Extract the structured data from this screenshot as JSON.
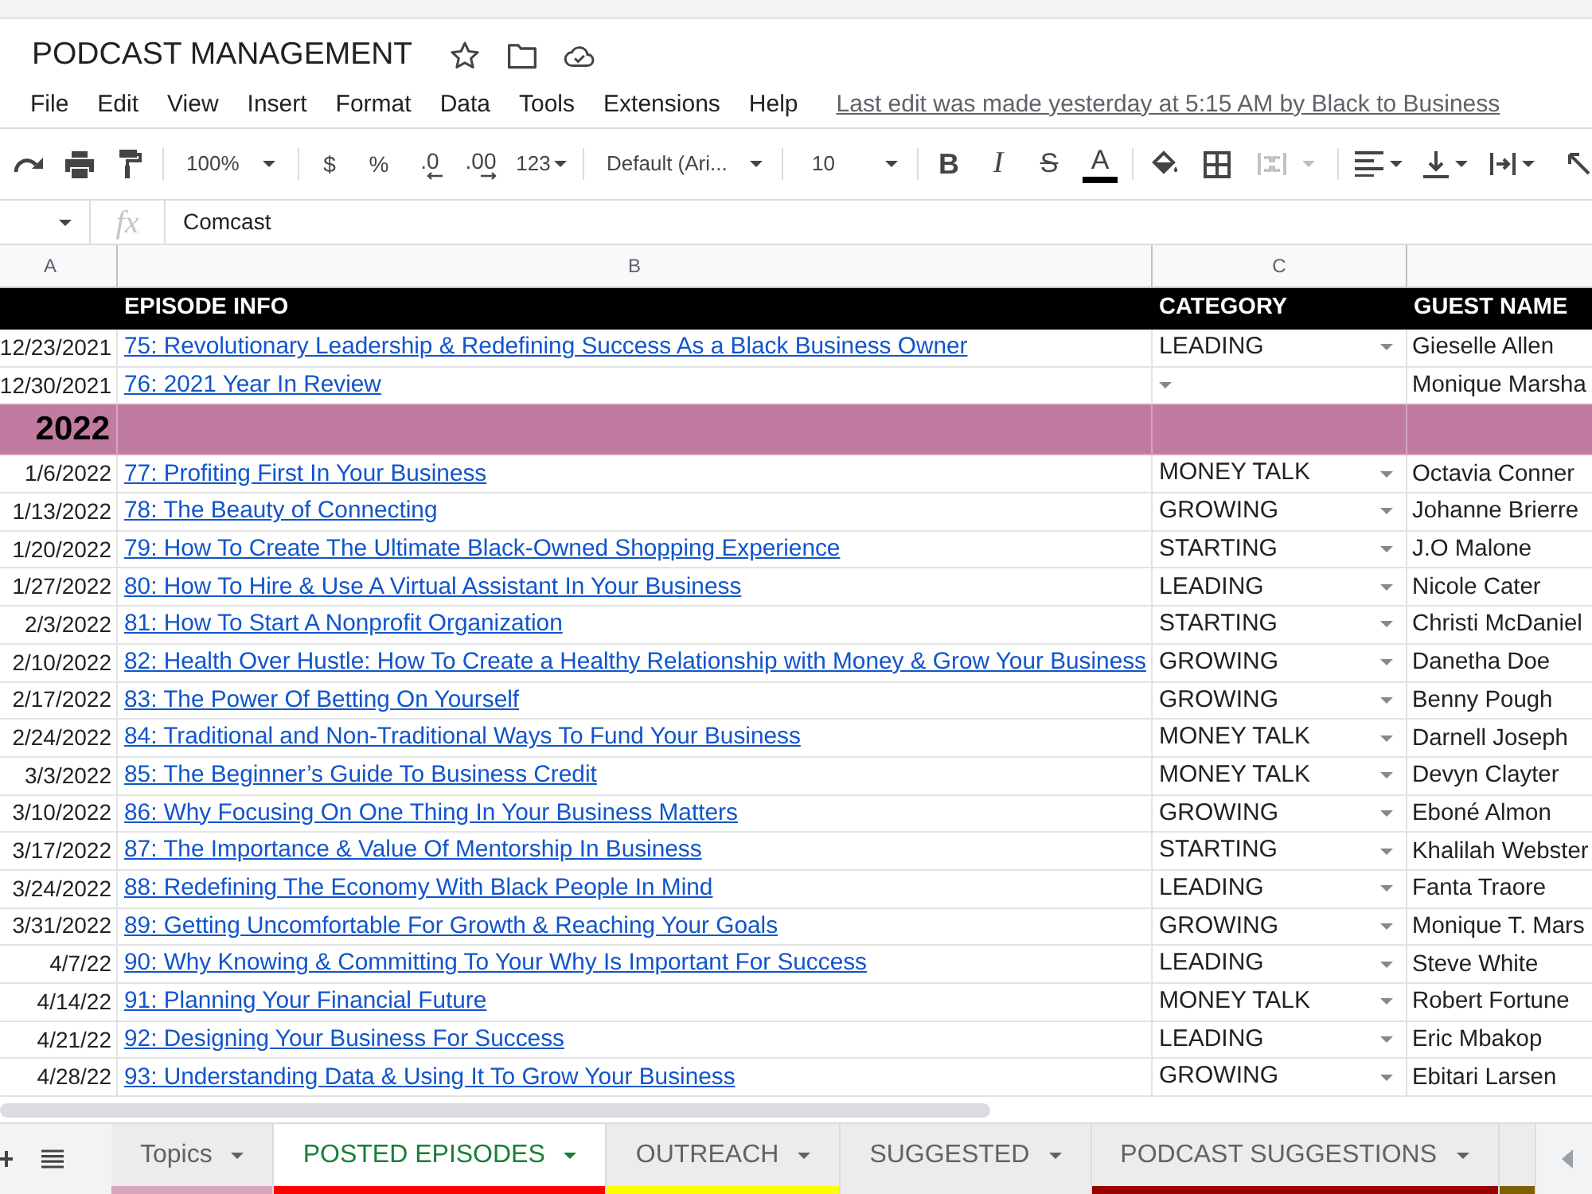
{
  "document": {
    "title": "PODCAST MANAGEMENT",
    "last_edit": "Last edit was made yesterday at 5:15 AM by Black to Business"
  },
  "menu": [
    "File",
    "Edit",
    "View",
    "Insert",
    "Format",
    "Data",
    "Tools",
    "Extensions",
    "Help"
  ],
  "toolbar": {
    "zoom": "100%",
    "currency": "$",
    "percent": "%",
    "decrease_decimals": ".0",
    "increase_decimals": ".00",
    "number_format": "123",
    "font": "Default (Ari...",
    "font_size": "10",
    "bold": "B",
    "italic": "I",
    "strikethrough": "S",
    "text_color": "A",
    "merge_disabled": true
  },
  "formula_bar": {
    "fx": "fx",
    "value": "Comcast"
  },
  "column_letters": [
    "A",
    "B",
    "C"
  ],
  "header_row": {
    "episode": "EPISODE INFO",
    "category": "CATEGORY",
    "guest": "GUEST NAME"
  },
  "rows": [
    {
      "kind": "episode",
      "date": "12/23/2021",
      "title": "75: Revolutionary Leadership & Redefining Success As a Black Business Owner",
      "category": "LEADING",
      "guest": "Gieselle Allen"
    },
    {
      "kind": "episode",
      "date": "12/30/2021",
      "title": "76: 2021 Year In Review",
      "guest": "Monique Marsha"
    },
    {
      "kind": "year",
      "label": "2022"
    },
    {
      "kind": "episode",
      "date": "1/6/2022",
      "title": "77: Profiting First In Your Business",
      "category": "MONEY TALK",
      "guest": "Octavia Conner"
    },
    {
      "kind": "episode",
      "date": "1/13/2022",
      "title": "78: The Beauty of Connecting",
      "category": "GROWING",
      "guest": "Johanne Brierre"
    },
    {
      "kind": "episode",
      "date": "1/20/2022",
      "title": "79: How To Create The Ultimate Black-Owned Shopping Experience",
      "category": "STARTING",
      "guest": "J.O Malone"
    },
    {
      "kind": "episode",
      "date": "1/27/2022",
      "title": "80: How To Hire & Use A Virtual Assistant In Your Business",
      "category": "LEADING",
      "guest": "Nicole Cater"
    },
    {
      "kind": "episode",
      "date": "2/3/2022",
      "title": "81: How To Start A Nonprofit Organization",
      "category": "STARTING",
      "guest": "Christi McDaniel"
    },
    {
      "kind": "episode",
      "date": "2/10/2022",
      "title": "82: Health Over Hustle: How To Create a Healthy Relationship with Money & Grow Your Business",
      "category": "GROWING",
      "guest": "Danetha Doe"
    },
    {
      "kind": "episode",
      "date": "2/17/2022",
      "title": "83: The Power Of Betting On Yourself",
      "category": "GROWING",
      "guest": "Benny Pough"
    },
    {
      "kind": "episode",
      "date": "2/24/2022",
      "title": "84: Traditional and Non-Traditional Ways To Fund Your Business",
      "category": "MONEY TALK",
      "guest": "Darnell Joseph"
    },
    {
      "kind": "episode",
      "date": "3/3/2022",
      "title": "85: The Beginner’s Guide To Business Credit",
      "category": "MONEY TALK",
      "guest": "Devyn Clayter"
    },
    {
      "kind": "episode",
      "date": "3/10/2022",
      "title": "86: Why Focusing On One Thing In Your Business Matters",
      "category": "GROWING",
      "guest": "Eboné Almon"
    },
    {
      "kind": "episode",
      "date": "3/17/2022",
      "title": "87: The Importance & Value Of Mentorship In Business",
      "category": "STARTING",
      "guest": "Khalilah Webster"
    },
    {
      "kind": "episode",
      "date": "3/24/2022",
      "title": "88: Redefining The Economy With Black People In Mind",
      "category": "LEADING",
      "guest": "Fanta Traore"
    },
    {
      "kind": "episode",
      "date": "3/31/2022",
      "title": "89: Getting Uncomfortable For Growth & Reaching Your Goals",
      "category": "GROWING",
      "guest": "Monique T. Mars"
    },
    {
      "kind": "episode",
      "date": "4/7/22",
      "title": "90: Why Knowing & Committing To Your Why Is Important For Success",
      "category": "LEADING",
      "guest": "Steve White"
    },
    {
      "kind": "episode",
      "date": "4/14/22",
      "title": "91: Planning Your Financial Future",
      "category": "MONEY TALK",
      "guest": "Robert Fortune"
    },
    {
      "kind": "episode",
      "date": "4/21/22",
      "title": "92: Designing Your Business For Success",
      "category": "LEADING",
      "guest": "Eric Mbakop"
    },
    {
      "kind": "episode",
      "date": "4/28/22",
      "title": "93: Understanding Data & Using It To Grow Your Business",
      "category": "GROWING",
      "guest": "Ebitari Larsen"
    }
  ],
  "sheet_tabs": [
    {
      "label": "Topics",
      "selected": false,
      "color": "#d5a6bd"
    },
    {
      "label": "POSTED EPISODES",
      "selected": true,
      "color": "#ff0000"
    },
    {
      "label": "OUTREACH",
      "selected": false,
      "color": "#ffff00"
    },
    {
      "label": "SUGGESTED",
      "selected": false
    },
    {
      "label": "PODCAST SUGGESTIONS",
      "selected": false,
      "color": "#990000"
    }
  ],
  "partial_tab": {
    "color": "#7f6000"
  }
}
